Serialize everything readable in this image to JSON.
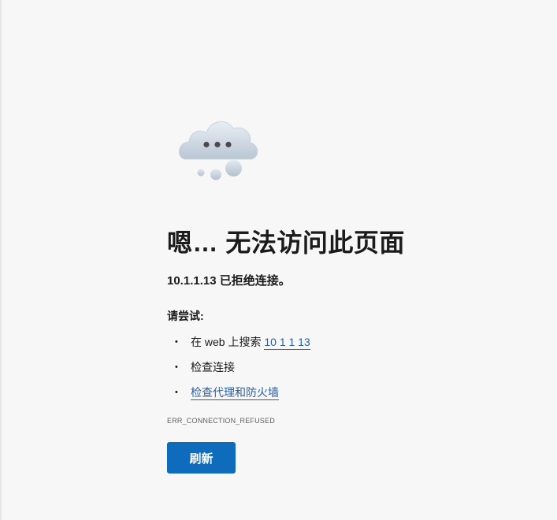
{
  "page": {
    "title": "嗯… 无法访问此页面",
    "message": "10.1.1.13 已拒绝连接。",
    "try_label": "请尝试:",
    "suggestions": [
      {
        "prefix": "在 web 上搜索 ",
        "link": "10 1 1 13"
      },
      {
        "prefix": "检查连接",
        "link": ""
      },
      {
        "prefix": "",
        "link": "检查代理和防火墙"
      }
    ],
    "bullet": "•",
    "error_code": "ERR_CONNECTION_REFUSED",
    "refresh_label": "刷新"
  },
  "icons": {
    "illustration": "cloud-with-dots-icon"
  },
  "colors": {
    "background": "#f7f7f7",
    "link": "#2a5fa0",
    "button": "#0f6cbd"
  }
}
